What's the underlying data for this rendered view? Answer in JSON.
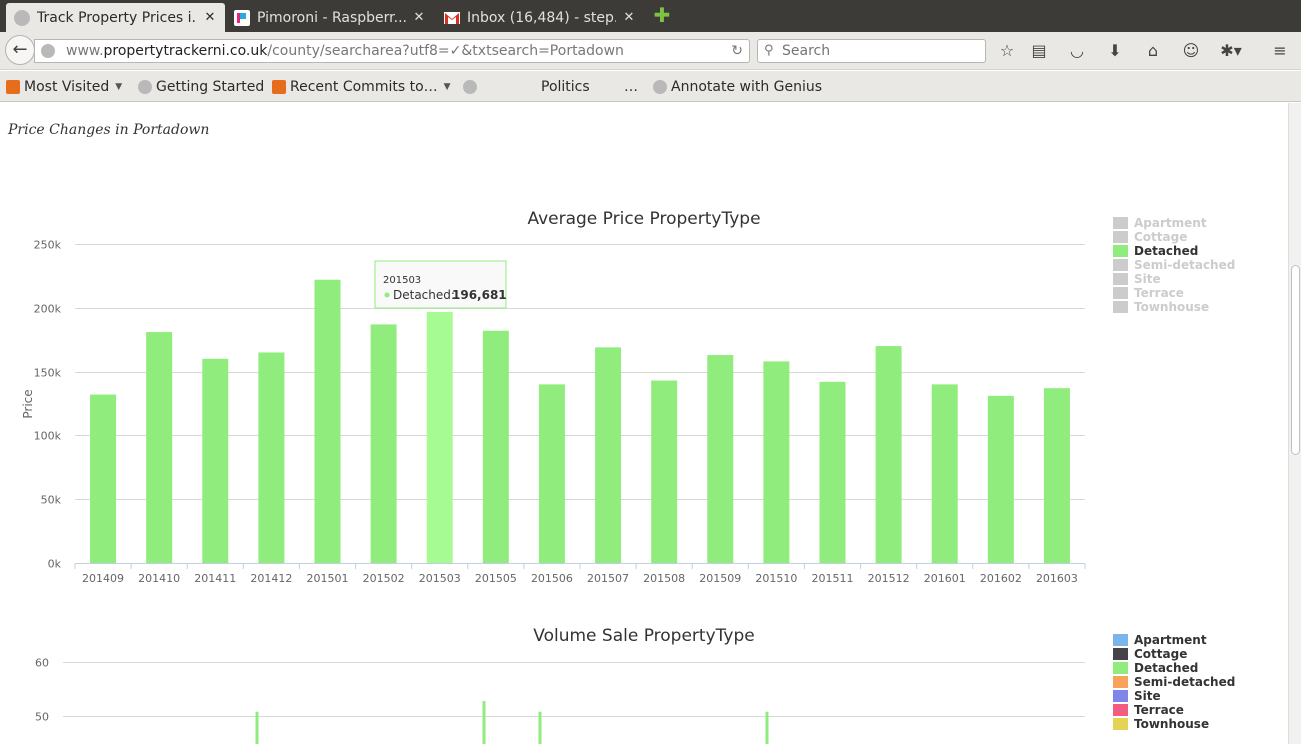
{
  "browser": {
    "tabs": [
      {
        "title": "Track Property Prices i...",
        "active": true,
        "favicon": "globe-icon"
      },
      {
        "title": "Pimoroni - Raspberr...",
        "active": false,
        "favicon": "pimoroni-icon"
      },
      {
        "title": "Inbox (16,484) - step...",
        "active": false,
        "favicon": "gmail-icon"
      }
    ],
    "close_glyph": "✕",
    "new_tab_glyph": "✚",
    "url": {
      "prefix": "www.",
      "host": "propertytrackerni.co.uk",
      "path": "/county/searcharea?utf8=✓&txtsearch=Portadown"
    },
    "search_placeholder": "Search",
    "bookmarks": [
      "Most Visited",
      "Getting Started",
      "Recent Commits to…",
      "",
      "Politics",
      "…",
      "Annotate with Genius"
    ]
  },
  "page": {
    "title": "Price Changes in Portadown"
  },
  "legend_entries": [
    "Apartment",
    "Cottage",
    "Detached",
    "Semi-detached",
    "Site",
    "Terrace",
    "Townhouse"
  ],
  "legend_colors": {
    "Apartment": "#7cb5ec",
    "Cottage": "#434348",
    "Detached": "#90ed7d",
    "Semi-detached": "#f7a35c",
    "Site": "#8085e9",
    "Terrace": "#f15c80",
    "Townhouse": "#e4d354",
    "disabled": "#cccccc"
  },
  "tooltip": {
    "period": "201503",
    "series": "Detached:",
    "value": "196,681"
  },
  "chart_data": [
    {
      "type": "bar",
      "title": "Average Price PropertyType",
      "ylabel": "Price",
      "xlabel": "",
      "ylim": [
        0,
        250000
      ],
      "yticks": [
        "0k",
        "50k",
        "100k",
        "150k",
        "200k",
        "250k"
      ],
      "categories": [
        "201409",
        "201410",
        "201411",
        "201412",
        "201501",
        "201502",
        "201503",
        "201505",
        "201506",
        "201507",
        "201508",
        "201509",
        "201510",
        "201511",
        "201512",
        "201601",
        "201602",
        "201603"
      ],
      "series": [
        {
          "name": "Detached",
          "values": [
            132000,
            181000,
            160000,
            165000,
            222000,
            187000,
            196681,
            182000,
            140000,
            169000,
            143000,
            163000,
            158000,
            142000,
            170000,
            140000,
            131000,
            137000
          ]
        }
      ],
      "hidden_series": [
        "Apartment",
        "Cottage",
        "Semi-detached",
        "Site",
        "Terrace",
        "Townhouse"
      ],
      "highlighted_category": "201503",
      "grid": true,
      "legend": "right"
    },
    {
      "type": "bar",
      "title": "Volume Sale PropertyType",
      "ylabel": "",
      "xlabel": "",
      "ylim": [
        40,
        60
      ],
      "yticks": [
        "50",
        "60"
      ],
      "legend": "right",
      "grid": true,
      "visible_bar_tops": [
        50.7,
        52.7,
        50.7,
        50.7
      ]
    }
  ]
}
